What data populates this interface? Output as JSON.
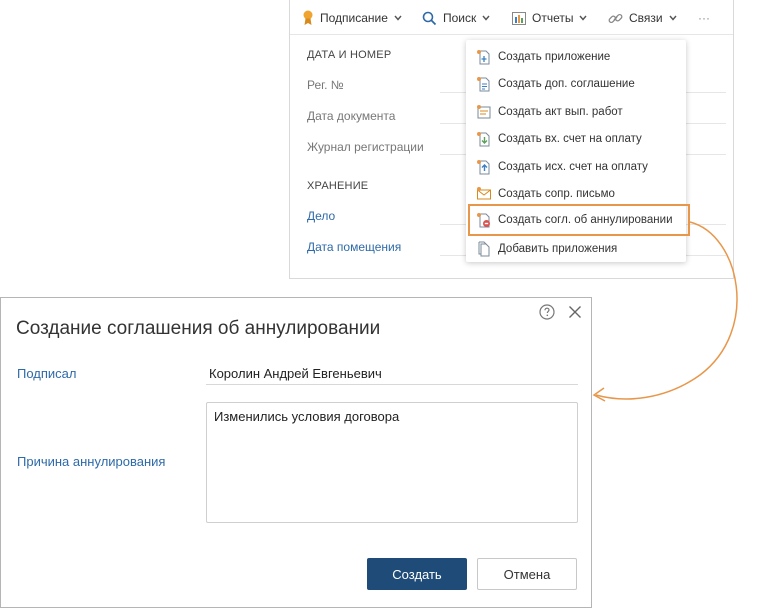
{
  "toolbar": {
    "signing_label": "Подписание",
    "search_label": "Поиск",
    "reports_label": "Отчеты",
    "links_label": "Связи",
    "more_label": "···"
  },
  "card": {
    "section_date": "ДАТА И НОМЕР",
    "reg_no_label": "Рег. №",
    "doc_date_label": "Дата документа",
    "journal_label": "Журнал регистрации",
    "section_storage": "ХРАНЕНИЕ",
    "case_label": "Дело",
    "placement_date_label": "Дата помещения"
  },
  "menu": {
    "items": [
      {
        "label": "Создать приложение",
        "icon": "attachment-add-icon"
      },
      {
        "label": "Создать доп. соглашение",
        "icon": "agreement-add-icon"
      },
      {
        "label": "Создать акт вып. работ",
        "icon": "act-add-icon"
      },
      {
        "label": "Создать вх. счет на оплату",
        "icon": "incoming-invoice-icon"
      },
      {
        "label": "Создать исх. счет на оплату",
        "icon": "outgoing-invoice-icon"
      },
      {
        "label": "Создать сопр. письмо",
        "icon": "letter-icon"
      },
      {
        "label": "Создать согл. об аннулировании",
        "icon": "cancel-agreement-icon"
      },
      {
        "label": "Добавить приложения",
        "icon": "add-attachments-icon"
      }
    ]
  },
  "colors": {
    "accent_orange": "#e8974a",
    "primary_button": "#1f4b78",
    "link_blue": "#2e6aa8"
  },
  "dialog": {
    "title": "Создание соглашения об аннулировании",
    "signed_by_label": "Подписал",
    "signed_by_value": "Королин Андрей Евгеньевич",
    "reason_label": "Причина аннулирования",
    "reason_value": "Изменились условия договора",
    "create_button": "Создать",
    "cancel_button": "Отмена"
  }
}
